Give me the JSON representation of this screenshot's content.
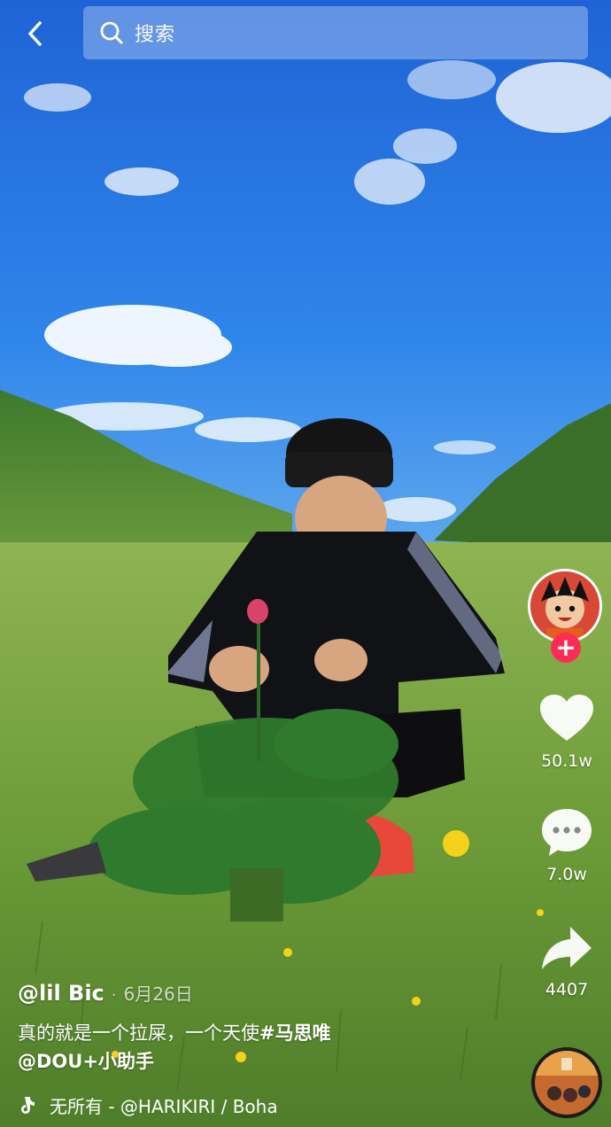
{
  "search": {
    "placeholder": "搜索"
  },
  "video": {
    "author": "@lil Bic",
    "separator": "·",
    "date": "6月26日",
    "description": "真的就是一个拉屎，一个天使",
    "hashtag": "#马思唯",
    "mention": "@DOU+小助手",
    "music": "无所有 - @HARIKIRI / Boha"
  },
  "actions": {
    "likes": "50.1w",
    "comments": "7.0w",
    "shares": "4407",
    "follow_symbol": "+"
  },
  "colors": {
    "accent": "#fe2c55",
    "sky": "#2f7fe0",
    "grass": "#6f9a3a"
  },
  "icons": {
    "back": "back-arrow-icon",
    "search": "search-icon",
    "like": "heart-icon",
    "comment": "comment-bubble-icon",
    "share": "share-arrow-icon",
    "music": "music-note-icon"
  }
}
